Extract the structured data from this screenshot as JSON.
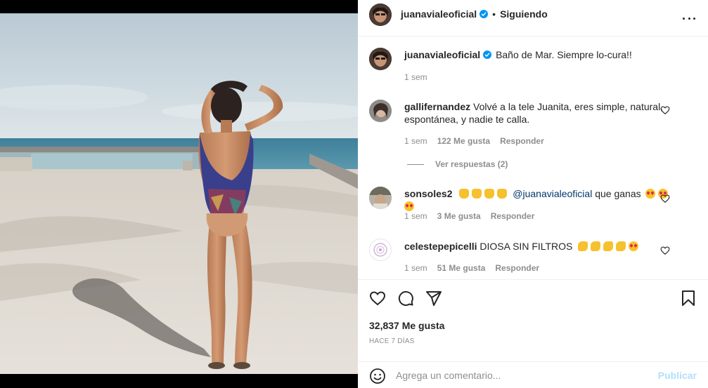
{
  "post": {
    "author": "juanavialeoficial",
    "follow_status": "Siguiendo",
    "separator": "•",
    "more_icon": "more-horizontal-icon",
    "verified_icon": "verified-badge-icon",
    "image_alt": "Mujer de espaldas en traje de baño frente al mar"
  },
  "caption": {
    "username": "juanavialeoficial",
    "text": "Baño de Mar. Siempre lo-cura!!",
    "time": "1 sem"
  },
  "comments": [
    {
      "username": "gallifernandez",
      "text": "Volvé a la tele Juanita, eres simple, natural, espontánea, y nadie te calla.",
      "time": "1 sem",
      "likes": "122 Me gusta",
      "reply": "Responder",
      "view_replies": "Ver respuestas (2)"
    },
    {
      "username": "sonsoles2",
      "mention": "@juanavialeoficial",
      "text_after": "que ganas",
      "time": "1 sem",
      "likes": "3 Me gusta",
      "reply": "Responder"
    },
    {
      "username": "celestepepicelli",
      "text": "DIOSA SIN FILTROS",
      "time": "1 sem",
      "likes": "51 Me gusta",
      "reply": "Responder"
    }
  ],
  "actions": {
    "like_icon": "heart-icon",
    "comment_icon": "comment-icon",
    "share_icon": "share-icon",
    "save_icon": "bookmark-icon",
    "likes_count": "32,837 Me gusta",
    "time_ago": "HACE 7 DÍAS"
  },
  "add_comment": {
    "placeholder": "Agrega un comentario...",
    "publish": "Publicar",
    "emoji_icon": "emoji-icon"
  },
  "colors": {
    "verified": "#0095f6",
    "publish_disabled": "#b2dffc",
    "text_primary": "#262626",
    "text_secondary": "#8e8e8e",
    "mention": "#00376b"
  }
}
